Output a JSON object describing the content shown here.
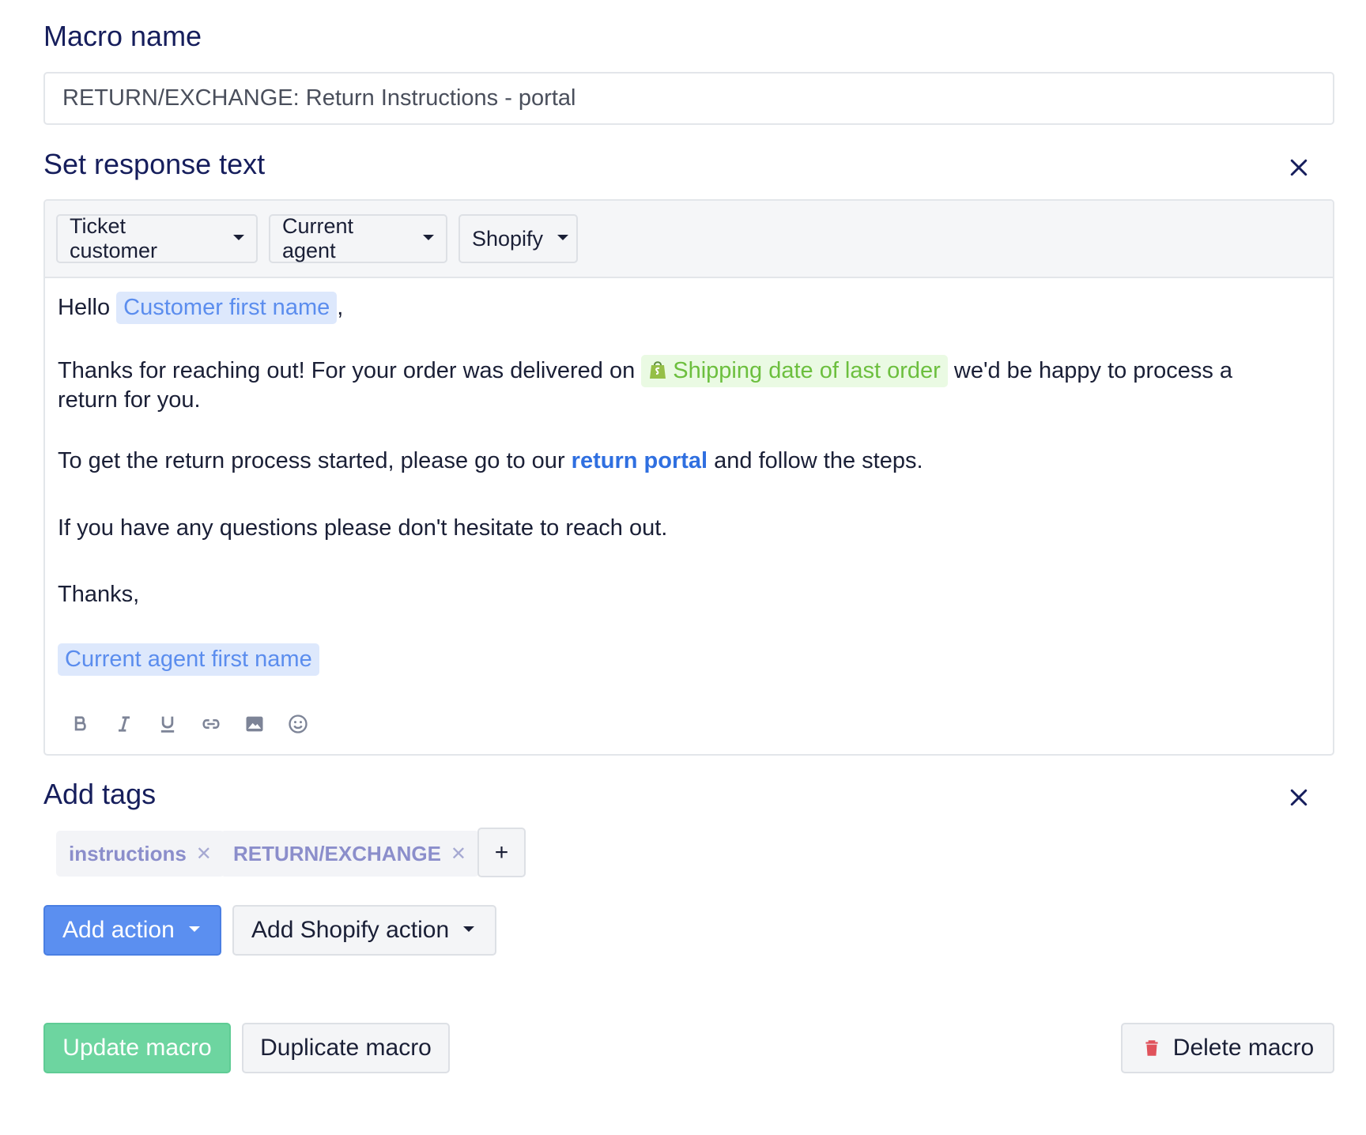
{
  "macro_name": {
    "label": "Macro name",
    "value": "RETURN/EXCHANGE: Return Instructions - portal"
  },
  "response": {
    "title": "Set response text",
    "variable_buttons": [
      "Ticket customer",
      "Current agent",
      "Shopify"
    ],
    "body": {
      "greeting_prefix": "Hello",
      "greeting_var": "Customer first name",
      "greeting_suffix": ",",
      "line2_prefix": "Thanks for reaching out! For your order was delivered on",
      "shipping_var": "Shipping date of last order",
      "line2_suffix": "we'd be happy to process a",
      "line2_cont": "return for you.",
      "line3_prefix": "To get the return process started, please go to our",
      "line3_link": "return portal",
      "line3_suffix": "and follow the steps.",
      "line4": "If you have any questions please don't hesitate to reach out.",
      "line5": "Thanks,",
      "signature_var": "Current agent first name"
    },
    "format_tools": [
      "bold-icon",
      "italic-icon",
      "underline-icon",
      "link-icon",
      "image-icon",
      "emoji-icon"
    ]
  },
  "tags": {
    "title": "Add tags",
    "items": [
      "instructions",
      "RETURN/EXCHANGE"
    ],
    "add_label": "+"
  },
  "actions": {
    "add_action": "Add action",
    "add_shopify_action": "Add Shopify action"
  },
  "footer": {
    "update": "Update macro",
    "duplicate": "Duplicate macro",
    "delete": "Delete macro"
  },
  "colors": {
    "title": "#161e5c",
    "primary": "#5b8ff0",
    "success": "#6dd5a0",
    "variable_chip": "#dde8fc",
    "shopify_chip": "#eafae3",
    "danger_icon": "#e0525b"
  }
}
